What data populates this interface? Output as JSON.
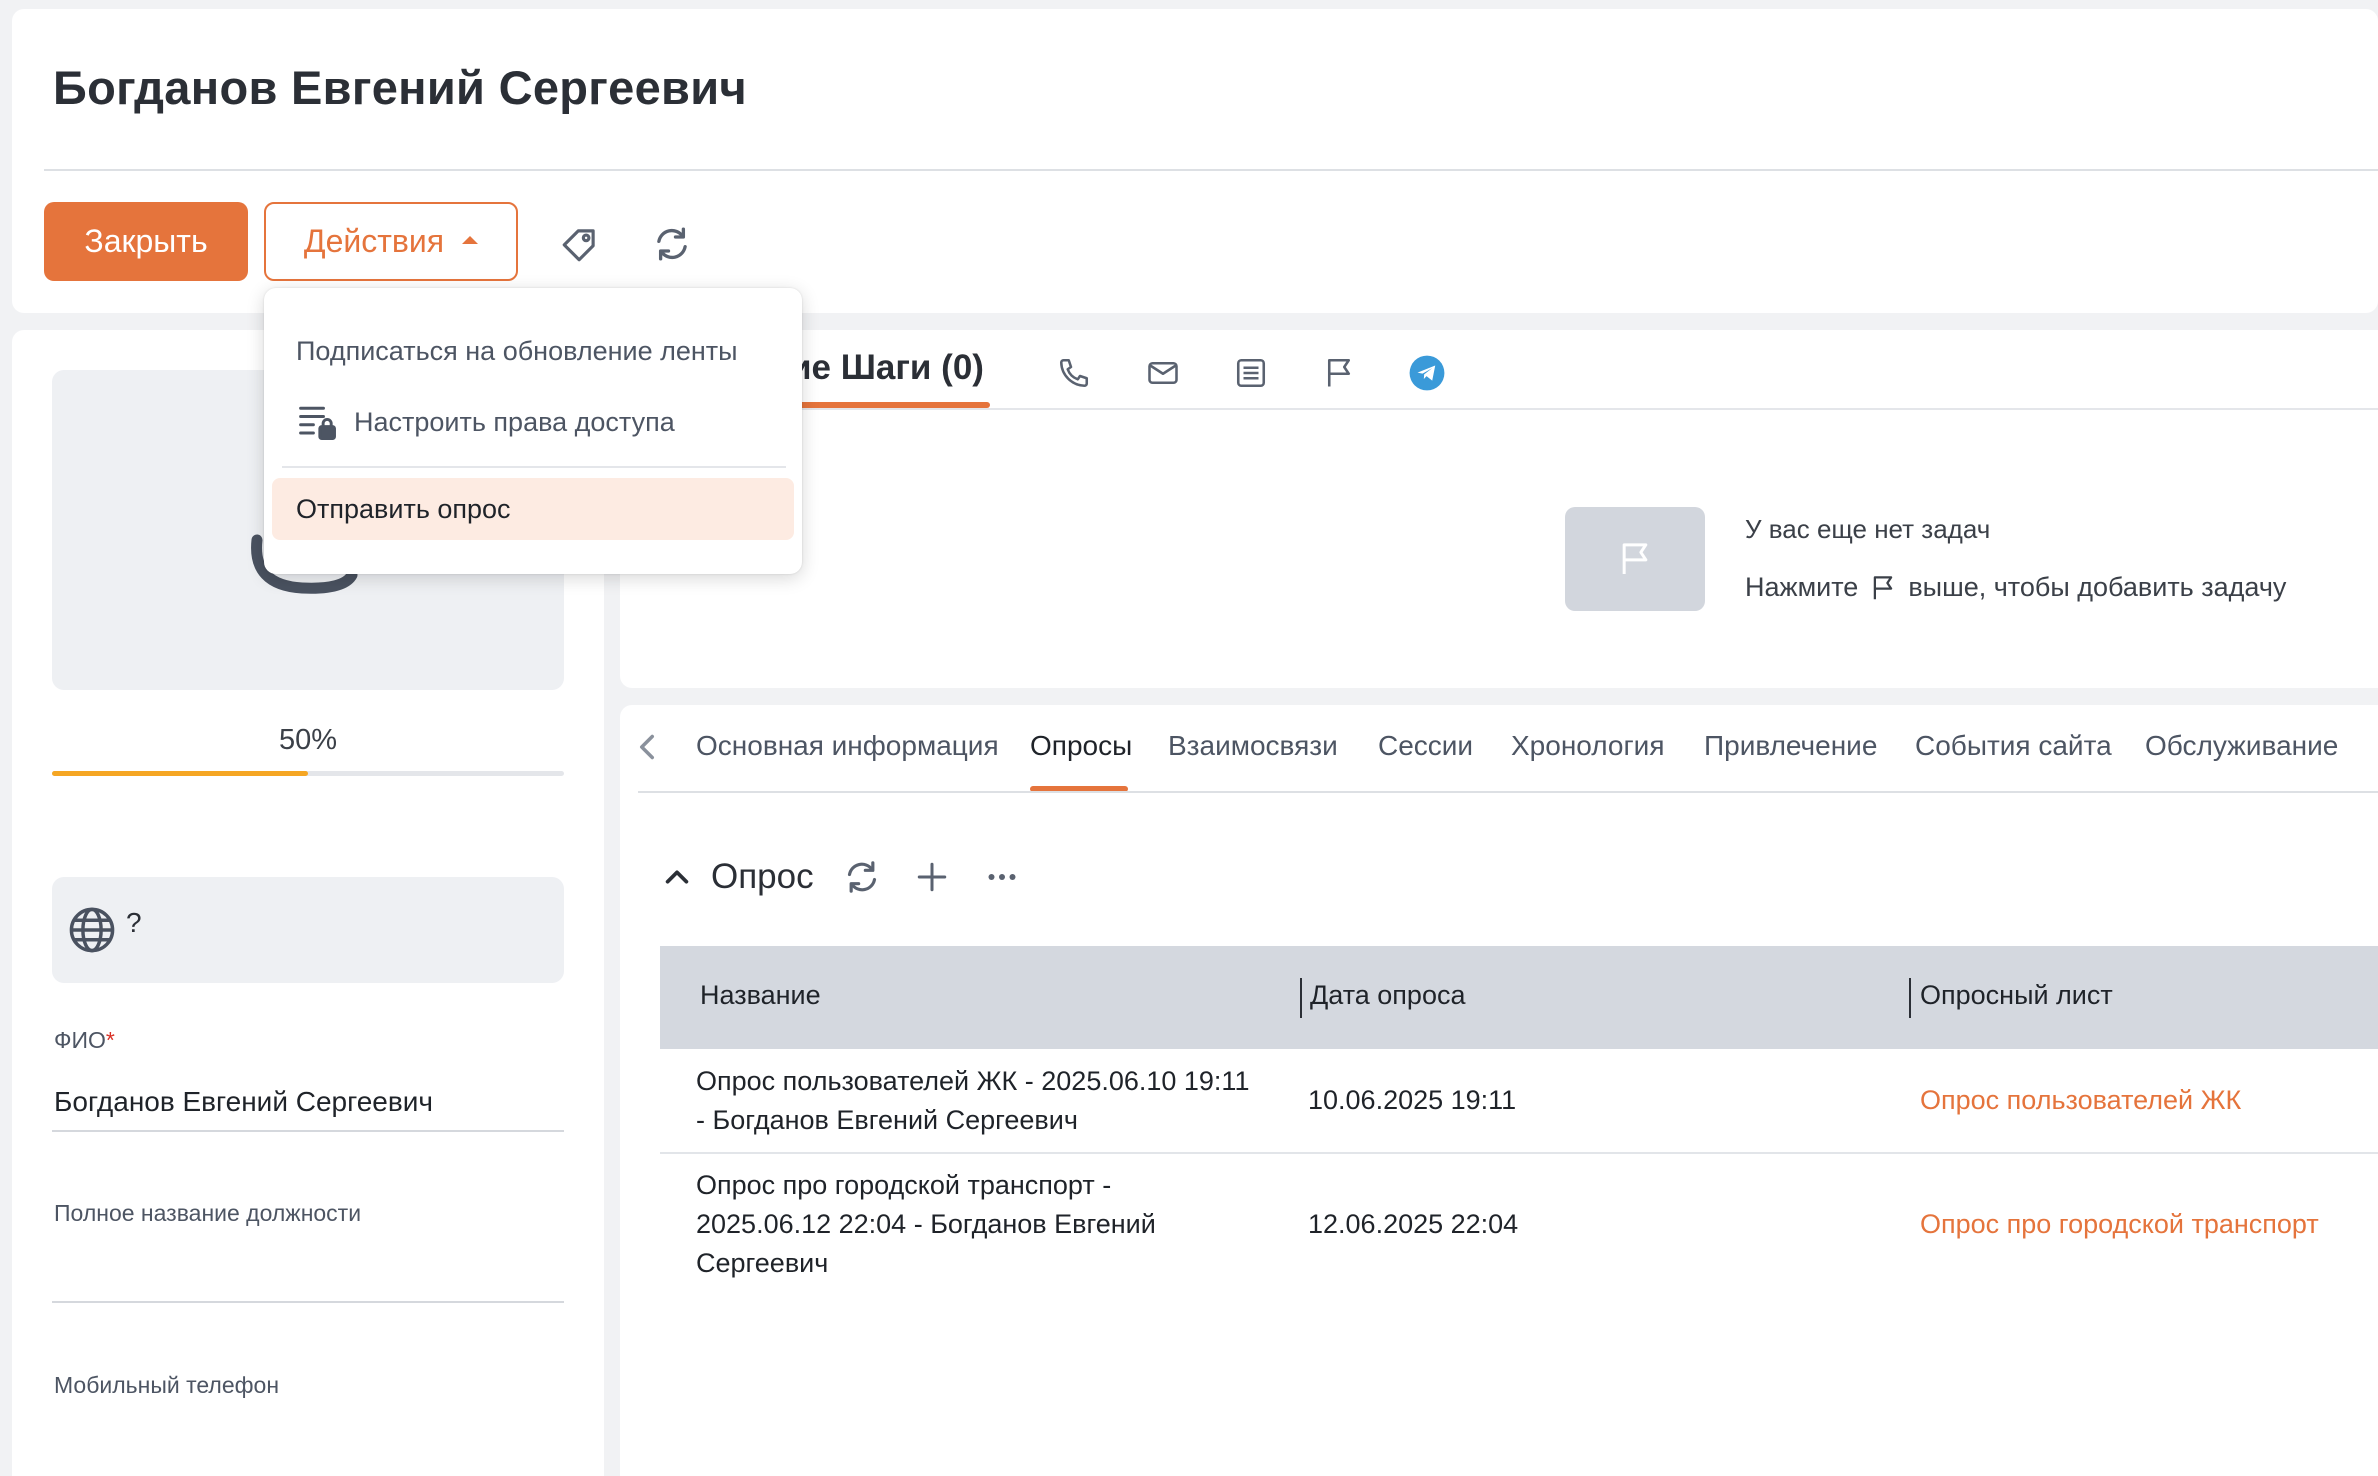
{
  "header": {
    "title": "Богданов Евгений Сергеевич",
    "close_label": "Закрыть",
    "actions_label": "Действия",
    "tag_icon": "tag-icon",
    "refresh_icon": "refresh-icon"
  },
  "actions_menu": {
    "items": [
      {
        "label": "Подписаться на обновление ленты",
        "icon": ""
      },
      {
        "label": "Настроить права доступа",
        "icon": "access-rights-icon"
      },
      {
        "label": "Отправить опрос",
        "icon": "",
        "highlighted": true
      }
    ]
  },
  "profile": {
    "completeness_label": "50%",
    "completeness_value": 0.5,
    "language_value": "?",
    "fields": [
      {
        "label": "ФИО",
        "required_mark": "*",
        "value": "Богданов Евгений Сергеевич"
      },
      {
        "label": "Полное название должности",
        "value": ""
      },
      {
        "label": "Мобильный телефон",
        "value": ""
      }
    ]
  },
  "next_steps": {
    "title": "Следующие Шаги (0)",
    "title_visible": "ие Шаги (0)",
    "icons": [
      "phone-icon",
      "mail-icon",
      "note-icon",
      "flag-icon",
      "telegram-icon"
    ],
    "empty_title": "У вас еще нет задач",
    "empty_hint_before": "Нажмите",
    "empty_hint_after": "выше, чтобы добавить задачу"
  },
  "tabs": [
    {
      "label": "Основная информация",
      "active": false
    },
    {
      "label": "Опросы",
      "active": true
    },
    {
      "label": "Взаимосвязи",
      "active": false
    },
    {
      "label": "Сессии",
      "active": false
    },
    {
      "label": "Хронология",
      "active": false
    },
    {
      "label": "Привлечение",
      "active": false
    },
    {
      "label": "События сайта",
      "active": false
    },
    {
      "label": "Обслуживание",
      "active": false
    }
  ],
  "survey_section": {
    "title": "Опрос",
    "columns": [
      "Название",
      "Дата опроса",
      "Опросный лист"
    ],
    "rows": [
      {
        "name_line1": "Опрос пользователей ЖК - 2025.06.10 19:11",
        "name_line2": "- Богданов Евгений Сергеевич",
        "date": "10.06.2025 19:11",
        "sheet": "Опрос пользователей ЖК"
      },
      {
        "name_line1": "Опрос про городской транспорт -",
        "name_line2": "2025.06.12 22:04 - Богданов Евгений",
        "name_line3": "Сергеевич",
        "date": "12.06.2025 22:04",
        "sheet": "Опрос про городской транспорт"
      }
    ]
  },
  "colors": {
    "accent": "#e5743c",
    "progress": "#f5a623",
    "telegram": "#3a9ad9"
  }
}
